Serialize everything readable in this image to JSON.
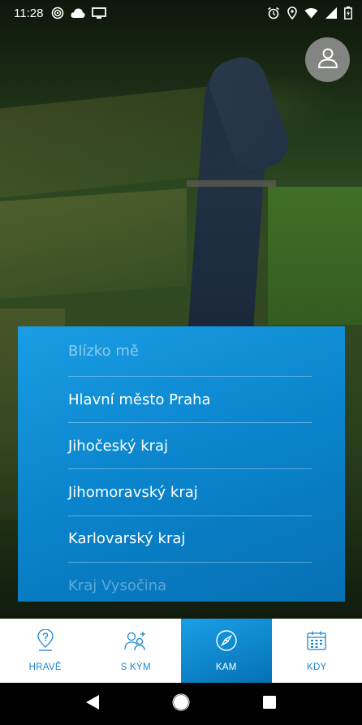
{
  "status_bar": {
    "time": "11:28",
    "left_icons": [
      "signal-spiral-icon",
      "cloud-icon",
      "cast-screen-icon"
    ],
    "right_icons": [
      "alarm-icon",
      "location-icon",
      "wifi-icon",
      "signal-icon",
      "battery-charging-icon"
    ]
  },
  "profile": {
    "icon": "user-icon"
  },
  "region_list": {
    "items": [
      "Blízko mě",
      "Hlavní město Praha",
      "Jihočeský kraj",
      "Jihomoravský kraj",
      "Karlovarský kraj",
      "Kraj Vysočina"
    ]
  },
  "bottom_nav": {
    "items": [
      {
        "label": "HRAVĚ",
        "icon": "map-pin-question-icon",
        "active": false
      },
      {
        "label": "S KÝM",
        "icon": "people-add-icon",
        "active": false
      },
      {
        "label": "KAM",
        "icon": "compass-icon",
        "active": true
      },
      {
        "label": "KDY",
        "icon": "calendar-icon",
        "active": false
      }
    ]
  },
  "system_nav": [
    "back-icon",
    "home-icon",
    "recents-icon"
  ],
  "colors": {
    "accent": "#0a84cc",
    "nav_text": "#1b86cc"
  }
}
